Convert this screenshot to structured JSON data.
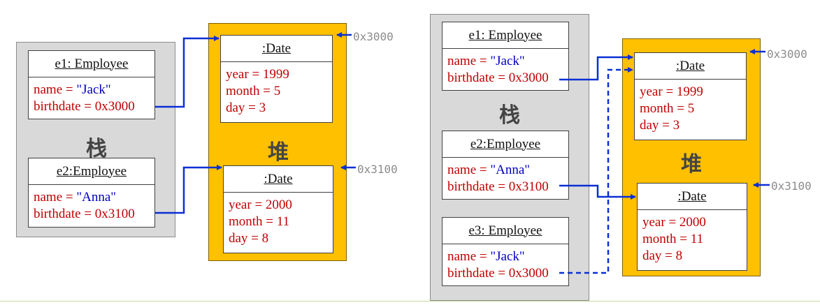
{
  "left": {
    "stack_label": "栈",
    "heap_label": "堆",
    "e1": {
      "title": "e1: Employee",
      "name_key": "name = ",
      "name_val": "\"Jack\"",
      "birthdate": "birthdate = 0x3000"
    },
    "e2": {
      "title": "e2:Employee",
      "name_key": "name = ",
      "name_val": "\"Anna\"",
      "birthdate": "birthdate = 0x3100"
    },
    "date1": {
      "title": ":Date",
      "year": "year = 1999",
      "month": "month = 5",
      "day": "day = 3",
      "addr": "0x3000"
    },
    "date2": {
      "title": ":Date",
      "year": "year = 2000",
      "month": "month = 11",
      "day": "day = 8",
      "addr": "0x3100"
    }
  },
  "right": {
    "stack_label": "栈",
    "heap_label": "堆",
    "e1": {
      "title": "e1: Employee",
      "name_key": "name = ",
      "name_val": "\"Jack\"",
      "birthdate": "birthdate = 0x3000"
    },
    "e2": {
      "title": "e2:Employee",
      "name_key": "name = ",
      "name_val": "\"Anna\"",
      "birthdate": "birthdate = 0x3100"
    },
    "e3": {
      "title": "e3: Employee",
      "name_key": "name = ",
      "name_val": "\"Jack\"",
      "birthdate": "birthdate = 0x3000"
    },
    "date1": {
      "title": ":Date",
      "year": "year = 1999",
      "month": "month = 5",
      "day": "day = 3",
      "addr": "0x3000"
    },
    "date2": {
      "title": ":Date",
      "year": "year = 2000",
      "month": "month = 11",
      "day": "day = 8",
      "addr": "0x3100"
    }
  },
  "colors": {
    "arrow": "#0a2fd6",
    "field": "#c00000",
    "string": "#0000c0",
    "heap": "#ffc000",
    "stack": "#d9d9d9",
    "address": "#8c8c8c"
  }
}
